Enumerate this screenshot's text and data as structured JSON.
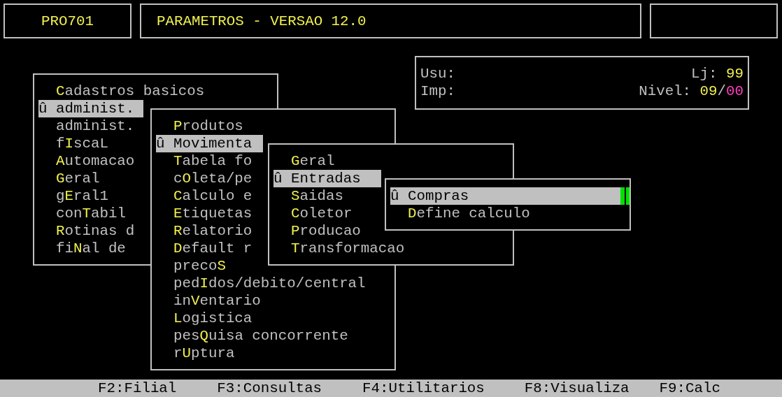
{
  "header": {
    "program": "PRO701",
    "title": "PARAMETROS - VERSAO 12.0"
  },
  "info": {
    "user_label": "Usu:",
    "printer_label": "Imp:",
    "store_label": "Lj:",
    "store": "99",
    "nivel_label": "Nivel:",
    "nivel_value": "09",
    "nivel_separator": "/",
    "nivel_max": "00"
  },
  "menus": [
    {
      "marker": "û",
      "items": [
        {
          "label": "**C**adastros basicos",
          "selected": false
        },
        {
          "label": "administ.",
          "selected": true
        },
        {
          "label": "administ.",
          "selected": false
        },
        {
          "label": "f**I**scaL",
          "selected": false
        },
        {
          "label": "**A**utomacao",
          "selected": false
        },
        {
          "label": "**G**eral",
          "selected": false
        },
        {
          "label": "g**E**ral1",
          "selected": false
        },
        {
          "label": "con**T**abil",
          "selected": false
        },
        {
          "label": "**R**otinas d",
          "selected": false
        },
        {
          "label": "fi**N**al de",
          "selected": false
        }
      ]
    },
    {
      "marker": "û",
      "items": [
        {
          "label": "**P**rodutos",
          "selected": false
        },
        {
          "label": "Movimenta",
          "selected": true
        },
        {
          "label": "**T**abela fo",
          "selected": false
        },
        {
          "label": "c**O**leta/pe",
          "selected": false
        },
        {
          "label": "**C**alculo e",
          "selected": false
        },
        {
          "label": "**E**tiquetas",
          "selected": false
        },
        {
          "label": "**R**elatorio",
          "selected": false
        },
        {
          "label": "**D**efault r",
          "selected": false
        },
        {
          "label": "preco**S**",
          "selected": false
        },
        {
          "label": "ped**I**dos/debito/central",
          "selected": false
        },
        {
          "label": "in**V**entario",
          "selected": false
        },
        {
          "label": "**L**ogistica",
          "selected": false
        },
        {
          "label": "pes**Q**uisa concorrente",
          "selected": false
        },
        {
          "label": "r**U**ptura",
          "selected": false
        }
      ]
    },
    {
      "marker": "û",
      "items": [
        {
          "label": "**G**eral",
          "selected": false
        },
        {
          "label": "Entradas",
          "selected": true
        },
        {
          "label": "**S**aidas",
          "selected": false
        },
        {
          "label": "**C**oletor",
          "selected": false
        },
        {
          "label": "**P**roducao",
          "selected": false
        },
        {
          "label": "**T**ransformacao",
          "selected": false
        }
      ]
    },
    {
      "marker": "û",
      "items": [
        {
          "label": "Compras",
          "selected": true
        },
        {
          "label": "**D**efine calculo",
          "selected": false
        }
      ]
    }
  ],
  "function_keys": [
    "F2:Filial",
    "F3:Consultas",
    "F4:Utilitarios",
    "F8:Visualiza",
    "F9:Calc"
  ]
}
